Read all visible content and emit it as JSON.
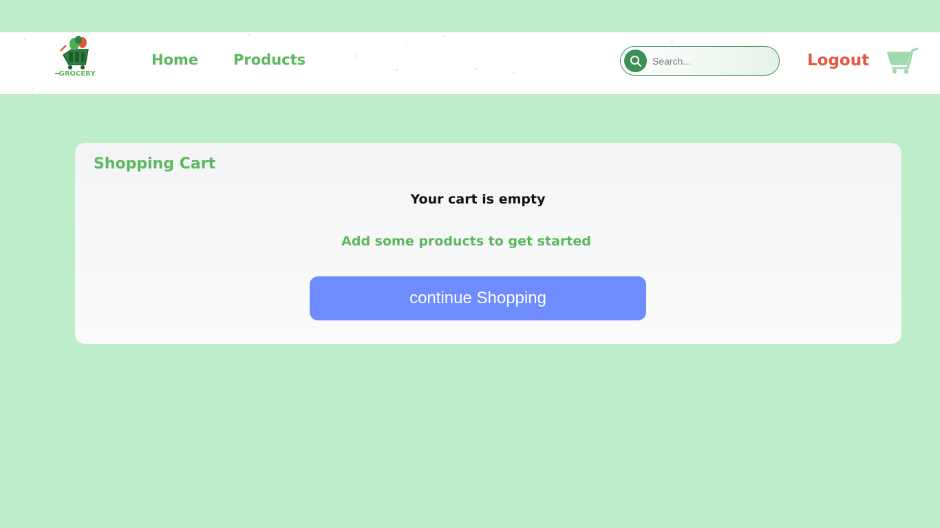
{
  "navbar": {
    "logo_text": "GROCERY",
    "links": [
      "Home",
      "Products"
    ],
    "search_placeholder": "Search...",
    "logout_label": "Logout",
    "search_icon": "search-icon",
    "cart_icon": "cart-icon"
  },
  "cart": {
    "title": "Shopping Cart",
    "empty_message": "Your cart is empty",
    "sub_message": "Add some products to get started",
    "continue_label": "continue Shopping"
  },
  "colors": {
    "background": "#bdedca",
    "brand_green": "#5cb85c",
    "search_green": "#3e8e57",
    "logout_red": "#e1583e",
    "button_blue": "#6f8cff"
  }
}
